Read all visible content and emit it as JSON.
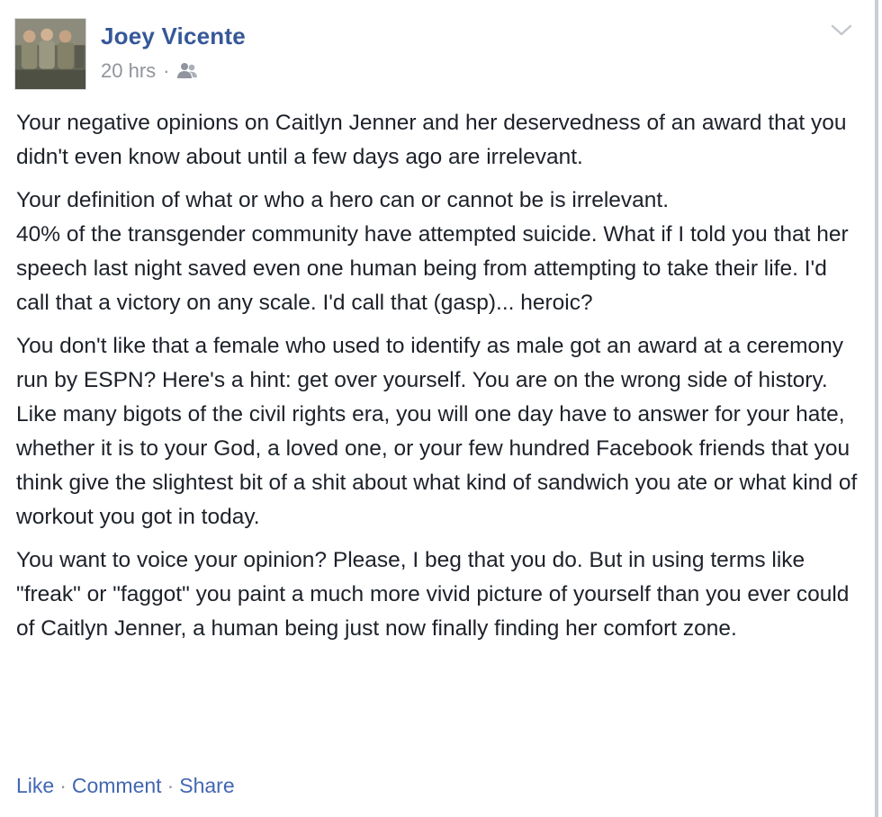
{
  "post": {
    "author": "Joey Vicente",
    "time": "20 hrs",
    "separator": "·",
    "privacy_icon": "friends-icon",
    "menu_icon": "chevron-down-icon",
    "paragraphs": [
      "Your negative opinions on Caitlyn Jenner and her deservedness of an award that you didn't even know about until a few days ago are irrelevant.",
      "Your definition of what or who a hero can or cannot be is irrelevant.",
      "40% of the transgender community have attempted suicide. What if I told you that her speech last night saved even one human being from attempting to take their life. I'd call that a victory on any scale. I'd call that (gasp)... heroic?",
      "You don't like that a female who used to identify as male got an award at a ceremony run by ESPN? Here's a hint: get over yourself. You are on the wrong side of history. Like many bigots of the civil rights era, you will one day have to answer for your hate, whether it is to your God, a loved one, or your few hundred Facebook friends that you think give the slightest bit of a shit about what kind of sandwich you ate or what kind of workout you got in today.",
      "You want to voice your opinion? Please, I beg that you do. But in using terms like \"freak\" or \"faggot\" you paint a much more vivid picture of yourself than you ever could of Caitlyn Jenner, a human being just now finally finding her comfort zone."
    ],
    "actions": {
      "like": "Like",
      "comment": "Comment",
      "share": "Share",
      "separator": "·"
    }
  },
  "colors": {
    "link": "#4267b2",
    "author": "#365899",
    "meta": "#90949c",
    "text": "#1d2129"
  }
}
